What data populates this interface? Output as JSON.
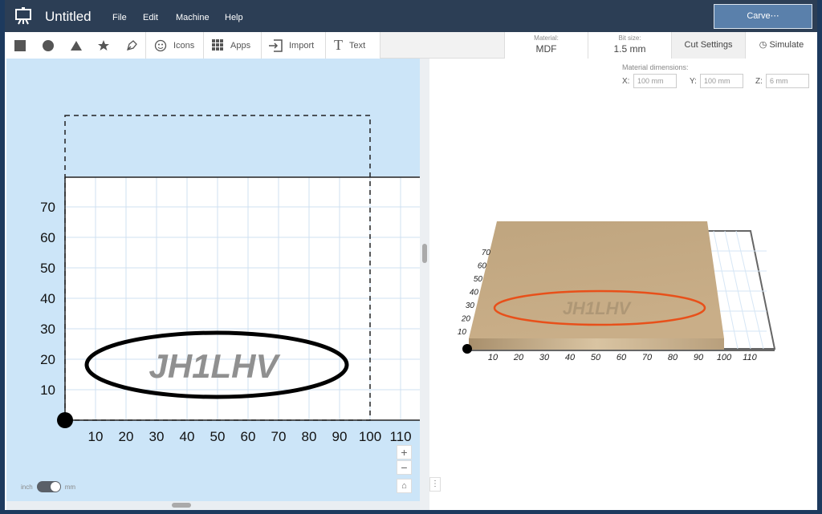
{
  "app": {
    "title": "Untitled",
    "menu": [
      "File",
      "Edit",
      "Machine",
      "Help"
    ],
    "carve_label": "Carve⋯"
  },
  "toolbar": {
    "shapes": [
      "square-icon",
      "circle-icon",
      "triangle-icon",
      "star-icon",
      "pen-icon"
    ],
    "icons_label": "Icons",
    "apps_label": "Apps",
    "import_label": "Import",
    "text_label": "Text",
    "material_label": "Material:",
    "material_value": "MDF",
    "bit_label": "Bit size:",
    "bit_value": "1.5 mm",
    "cut_settings_label": "Cut Settings",
    "simulate_label": "Simulate"
  },
  "dimensions": {
    "label": "Material dimensions:",
    "x_label": "X:",
    "x_value": "100 mm",
    "y_label": "Y:",
    "y_value": "100 mm",
    "z_label": "Z:",
    "z_value": "6 mm"
  },
  "canvas": {
    "design_text": "JH1LHV",
    "x_ticks": [
      "10",
      "20",
      "30",
      "40",
      "50",
      "60",
      "70",
      "80",
      "90",
      "100",
      "110"
    ],
    "y_ticks": [
      "10",
      "20",
      "30",
      "40",
      "50",
      "60",
      "70"
    ],
    "units_left": "inch",
    "units_right": "mm",
    "units_selected": "mm"
  },
  "preview": {
    "x_ticks": [
      "10",
      "20",
      "30",
      "40",
      "50",
      "60",
      "70",
      "80",
      "90",
      "100",
      "110"
    ],
    "y_ticks": [
      "10",
      "20",
      "30",
      "40",
      "50",
      "60",
      "70"
    ],
    "cut_color": "#e8501a"
  },
  "colors": {
    "titlebar": "#2c3e55",
    "carve": "#5a80ab",
    "canvas_bg": "#cce5f8"
  }
}
